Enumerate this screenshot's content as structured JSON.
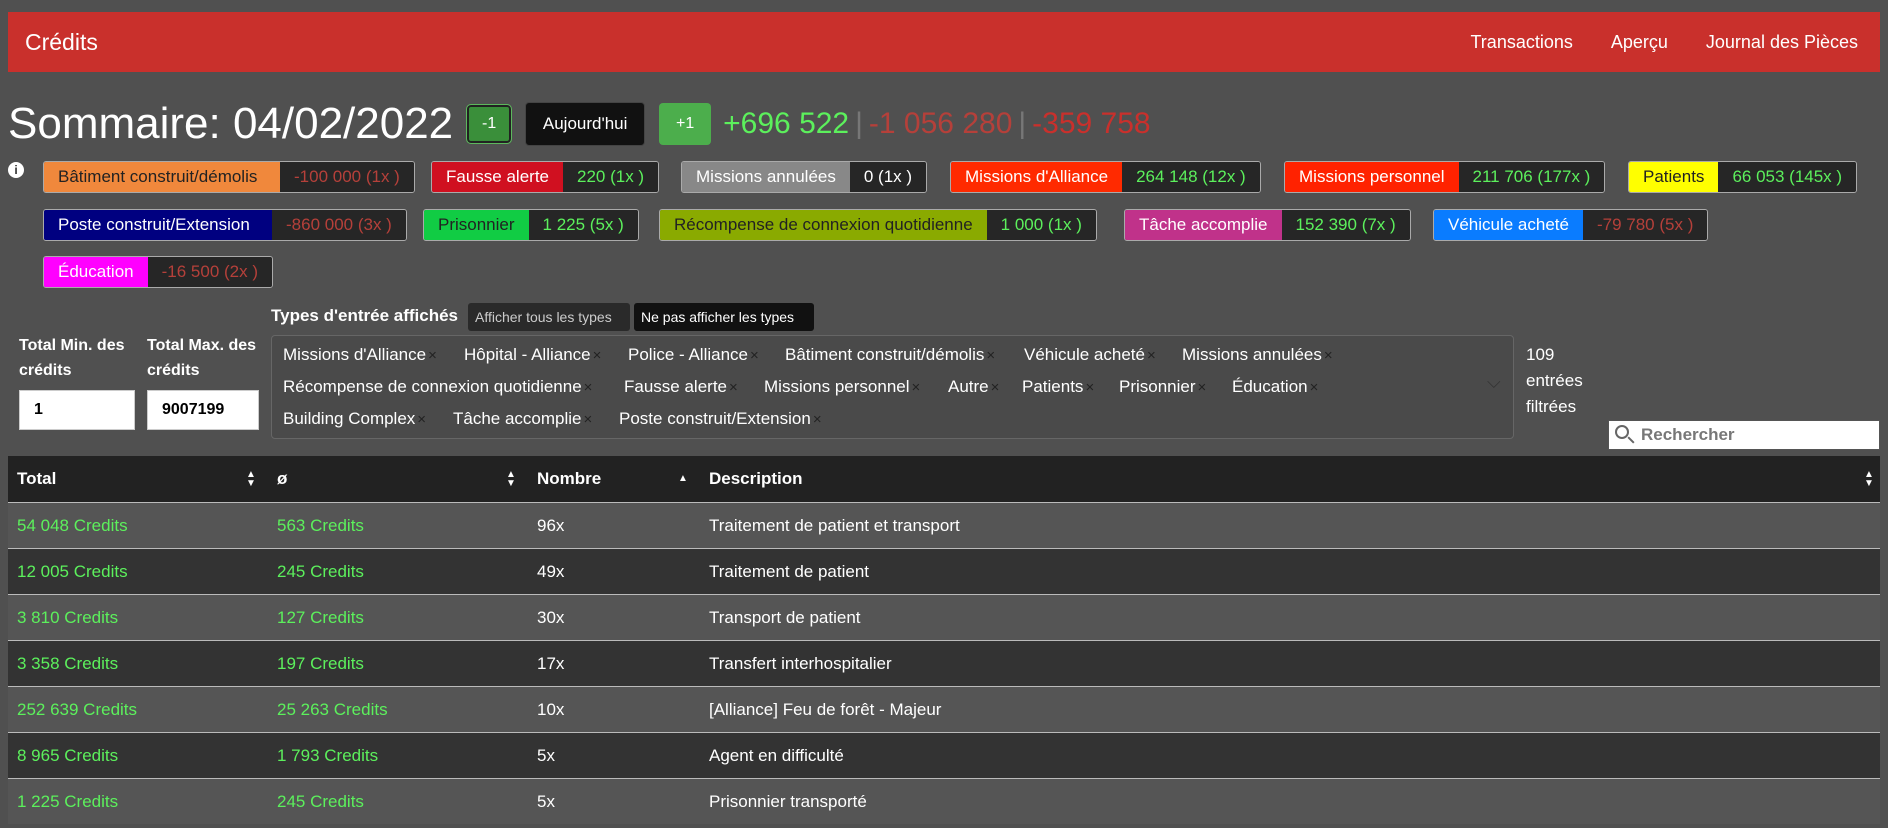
{
  "navbar": {
    "brand": "Crédits",
    "links": [
      "Transactions",
      "Aperçu",
      "Journal des Pièces"
    ]
  },
  "summary": {
    "title": "Sommaire: 04/02/2022",
    "prev_label": "-1",
    "today_label": "Aujourd'hui",
    "next_label": "+1",
    "positive": "+696 522",
    "separator": "|",
    "negative": "-1 056 280",
    "total": "-359 758"
  },
  "badges": [
    {
      "label": "Bâtiment construit/démolis",
      "value": "-100 000 (1x )",
      "color": "#f0883c",
      "text_color": "#222",
      "tone": "neg"
    },
    {
      "label": "Fausse alerte",
      "value": "220 (1x )",
      "color": "#d01020",
      "text_color": "#fff",
      "tone": "pos"
    },
    {
      "label": "Missions annulées",
      "value": "0 (1x )",
      "color": "#888888",
      "text_color": "#fff",
      "tone": "neu"
    },
    {
      "label": "Missions d'Alliance",
      "value": "264 148 (12x )",
      "color": "#ff2a00",
      "text_color": "#fff",
      "tone": "pos"
    },
    {
      "label": "Missions personnel",
      "value": "211 706 (177x )",
      "color": "#ff2200",
      "text_color": "#fff",
      "tone": "pos"
    },
    {
      "label": "Patients",
      "value": "66 053 (145x )",
      "color": "#ffff00",
      "text_color": "#222",
      "tone": "pos"
    },
    {
      "label": "Poste construit/Extension",
      "value": "-860 000 (3x )",
      "color": "#000080",
      "text_color": "#fff",
      "tone": "neg"
    },
    {
      "label": "Prisonnier",
      "value": "1 225 (5x )",
      "color": "#11cc44",
      "text_color": "#222",
      "tone": "pos"
    },
    {
      "label": "Récompense de connexion quotidienne",
      "value": "1 000 (1x )",
      "color": "#8aaa00",
      "text_color": "#222",
      "tone": "pos"
    },
    {
      "label": "Tâche accomplie",
      "value": "152 390 (7x )",
      "color": "#c0328a",
      "text_color": "#fff",
      "tone": "pos"
    },
    {
      "label": "Véhicule acheté",
      "value": "-79 780 (5x )",
      "color": "#0a7cff",
      "text_color": "#fff",
      "tone": "neg"
    },
    {
      "label": "Éducation",
      "value": "-16 500 (2x )",
      "color": "#ff00ff",
      "text_color": "#fff",
      "tone": "neg"
    }
  ],
  "filters": {
    "min_label": "Total Min. des crédits",
    "min_value": "1",
    "max_label": "Total Max. des crédits",
    "max_value": "9007199",
    "types_label": "Types d'entrée affichés",
    "show_all": "Afficher tous les types",
    "hide_all": "Ne pas afficher les types",
    "types": [
      "Missions d'Alliance",
      "Hôpital - Alliance",
      "Police - Alliance",
      "Bâtiment construit/démolis",
      "Véhicule acheté",
      "Missions annulées",
      "Récompense de connexion quotidienne",
      "Fausse alerte",
      "Missions personnel",
      "Autre",
      "Patients",
      "Prisonnier",
      "Éducation",
      "Building Complex",
      "Tâche accomplie",
      "Poste construit/Extension"
    ],
    "remove_glyph": "×",
    "filtered_count": "109 entrées filtrées",
    "search_placeholder": "Rechercher"
  },
  "table": {
    "headers": [
      "Total",
      "ø",
      "Nombre",
      "Description"
    ],
    "rows": [
      {
        "total": "54 048 Credits",
        "avg": "563 Credits",
        "count": "96x",
        "desc": "Traitement de patient et transport"
      },
      {
        "total": "12 005 Credits",
        "avg": "245 Credits",
        "count": "49x",
        "desc": "Traitement de patient"
      },
      {
        "total": "3 810 Credits",
        "avg": "127 Credits",
        "count": "30x",
        "desc": "Transport de patient"
      },
      {
        "total": "3 358 Credits",
        "avg": "197 Credits",
        "count": "17x",
        "desc": "Transfert interhospitalier"
      },
      {
        "total": "252 639 Credits",
        "avg": "25 263 Credits",
        "count": "10x",
        "desc": "[Alliance] Feu de forêt - Majeur"
      },
      {
        "total": "8 965 Credits",
        "avg": "1 793 Credits",
        "count": "5x",
        "desc": "Agent en difficulté"
      },
      {
        "total": "1 225 Credits",
        "avg": "245 Credits",
        "count": "5x",
        "desc": "Prisonnier transporté"
      }
    ]
  }
}
